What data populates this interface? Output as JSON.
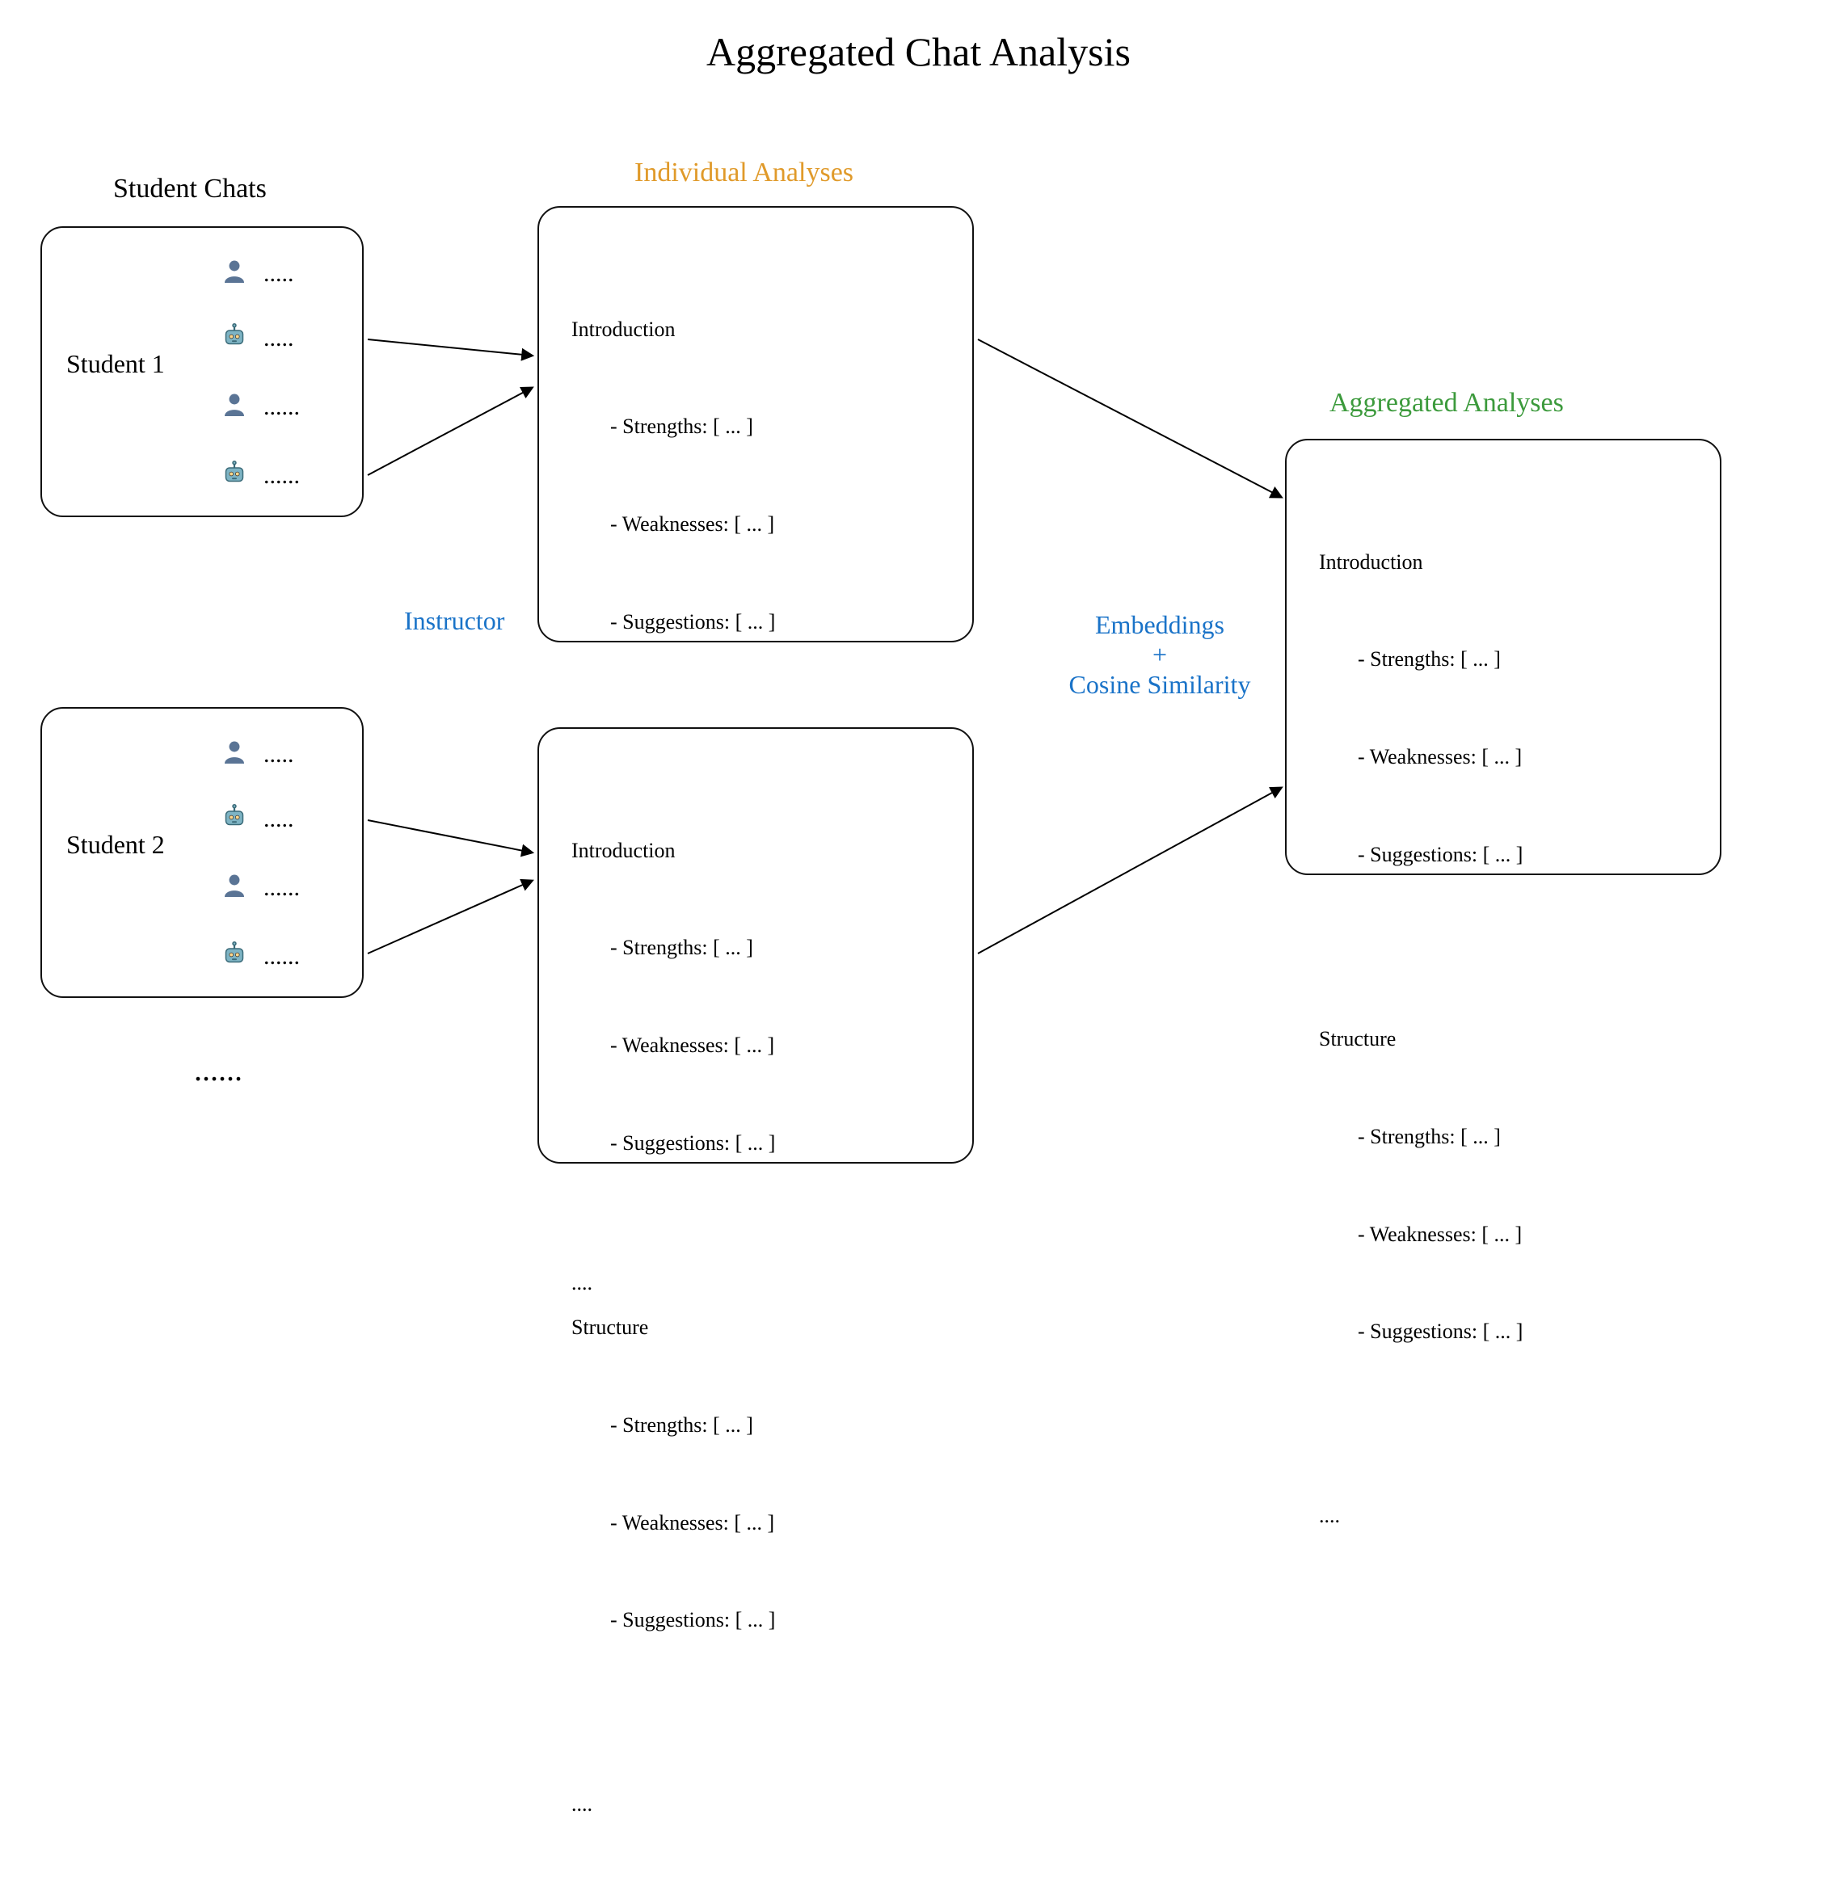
{
  "title": "Aggregated Chat Analysis",
  "labels": {
    "student_chats": "Student Chats",
    "individual": "Individual Analyses",
    "aggregated": "Aggregated Analyses",
    "instructor": "Instructor",
    "embeddings_line1": "Embeddings",
    "embeddings_plus": "+",
    "embeddings_line2": "Cosine Similarity"
  },
  "students": {
    "s1": {
      "name": "Student 1",
      "rows": [
        ".....",
        ".....",
        "......",
        "......"
      ]
    },
    "s2": {
      "name": "Student 2",
      "rows": [
        ".....",
        ".....",
        "......",
        "......"
      ]
    }
  },
  "analysis_block": {
    "section1": "Introduction",
    "strengths": "- Strengths: [ ... ]",
    "weaknesses": "- Weaknesses: [ ... ]",
    "suggestions": "- Suggestions: [ ... ]",
    "section2": "Structure",
    "trailing": "...."
  },
  "bottom_ellipsis": "......"
}
